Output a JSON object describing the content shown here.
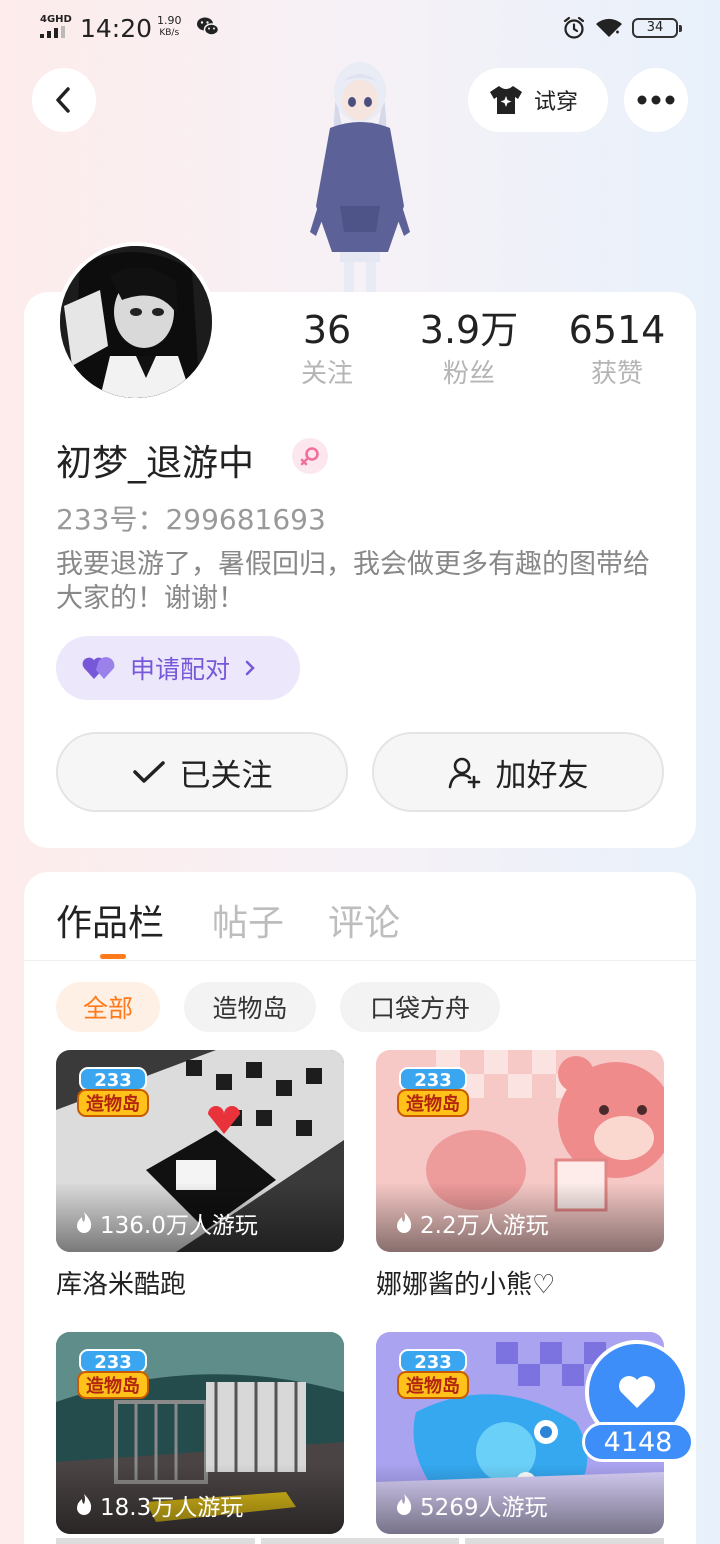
{
  "status_bar": {
    "network": "4GHD",
    "time": "14:20",
    "speed_value": "1.90",
    "speed_unit": "KB/s",
    "battery": "34"
  },
  "nav": {
    "back_icon": "chevron-left-icon",
    "tryon_label": "试穿",
    "tryon_icon": "shirt-sparkle-icon",
    "more_icon": "more-dots-icon"
  },
  "profile": {
    "stats": [
      {
        "value": "36",
        "label": "关注"
      },
      {
        "value": "3.9万",
        "label": "粉丝"
      },
      {
        "value": "6514",
        "label": "获赞"
      }
    ],
    "username": "初梦_退游中",
    "gender_icon": "female-icon",
    "uid": "233号：299681693",
    "bio": "我要退游了，暑假回归，我会做更多有趣的图带给大家的！谢谢！",
    "match_label": "申请配对",
    "follow_label": "已关注",
    "add_friend_label": "加好友"
  },
  "works": {
    "tabs": [
      "作品栏",
      "帖子",
      "评论"
    ],
    "chips": [
      "全部",
      "造物岛",
      "口袋方舟"
    ],
    "badge_top": "233",
    "badge_bottom": "造物岛",
    "games": [
      {
        "title": "库洛米酷跑",
        "plays": "136.0万人游玩"
      },
      {
        "title": "娜娜酱的小熊♡",
        "plays": "2.2万人游玩"
      },
      {
        "title": "",
        "plays": "18.3万人游玩"
      },
      {
        "title": "",
        "plays": "5269人游玩"
      }
    ]
  },
  "like": {
    "count": "4148"
  },
  "colors": {
    "accent": "#ff7a1a",
    "like_blue": "#3d8ef8",
    "match_purple": "#7758d9"
  }
}
